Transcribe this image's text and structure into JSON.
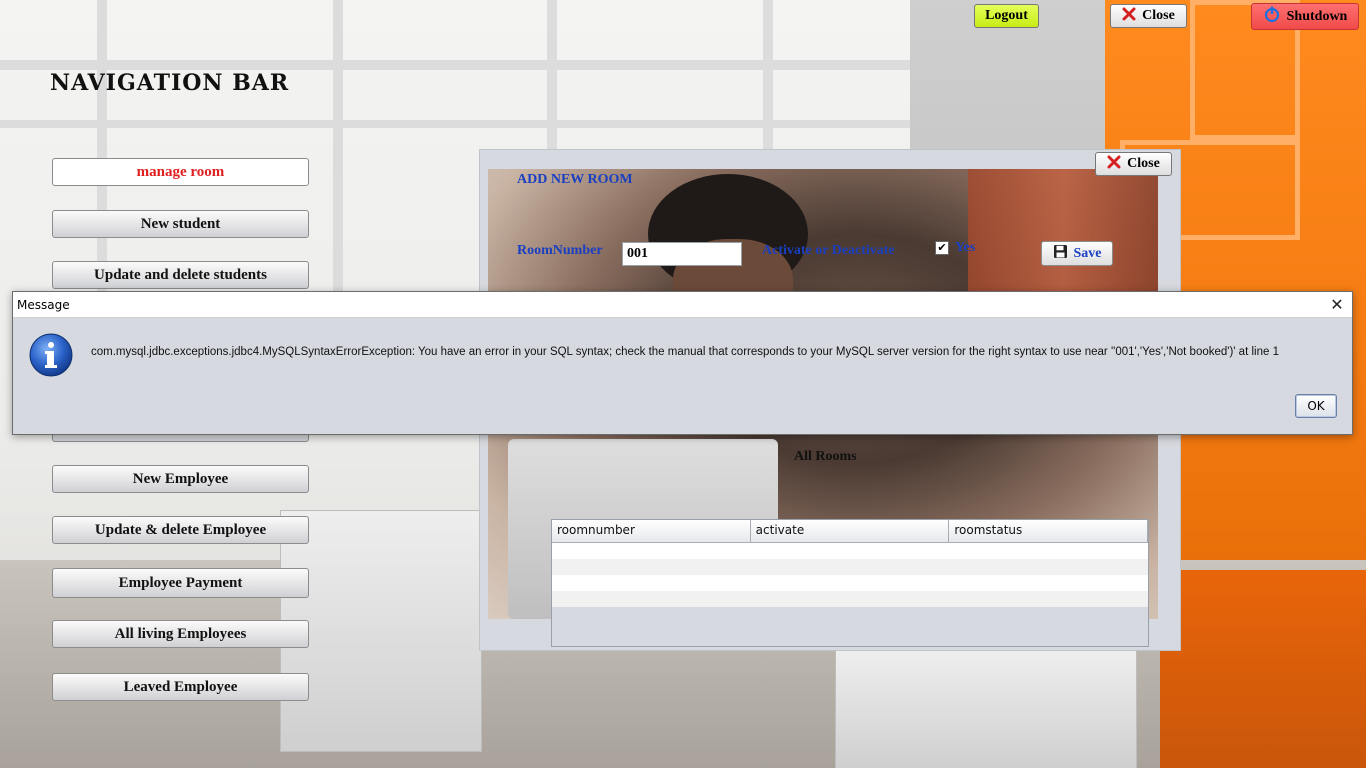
{
  "topbar": {
    "logout_label": "Logout",
    "close_label": "Close",
    "shutdown_label": "Shutdown"
  },
  "nav": {
    "title": "NAVIGATION BAR",
    "items": [
      {
        "label": "manage room",
        "active": true
      },
      {
        "label": "New student"
      },
      {
        "label": "Update and delete students"
      },
      {
        "label": ""
      },
      {
        "label": "New Employee"
      },
      {
        "label": "Update & delete Employee"
      },
      {
        "label": "Employee Payment"
      },
      {
        "label": "All living Employees"
      },
      {
        "label": "Leaved Employee"
      }
    ]
  },
  "room_panel": {
    "close_label": "Close",
    "title": "ADD NEW ROOM",
    "room_number_label": "RoomNumber",
    "room_number_value": "001",
    "activate_label": "Activate or Deactivate",
    "yes_label": "Yes",
    "yes_checked": true,
    "save_label": "Save",
    "all_rooms_label": "All Rooms",
    "table": {
      "columns": [
        "roomnumber",
        "activate",
        "roomstatus"
      ],
      "rows": []
    }
  },
  "dialog": {
    "title": "Message",
    "message": "com.mysql.jdbc.exceptions.jdbc4.MySQLSyntaxErrorException: You have an error in your SQL syntax; check the manual that corresponds to your MySQL server version for the right syntax to use near ''001','Yes','Not booked')' at line 1",
    "ok_label": "OK",
    "close_glyph": "✕"
  },
  "icons": {
    "close": "close-x-icon",
    "shutdown": "power-icon",
    "save": "floppy-disk-icon",
    "info": "info-icon"
  },
  "colors": {
    "accent_blue": "#1a3fc0",
    "active_red": "#e02020",
    "logout_bg": "#d6f51e",
    "shutdown_bg": "#f04a4a"
  }
}
